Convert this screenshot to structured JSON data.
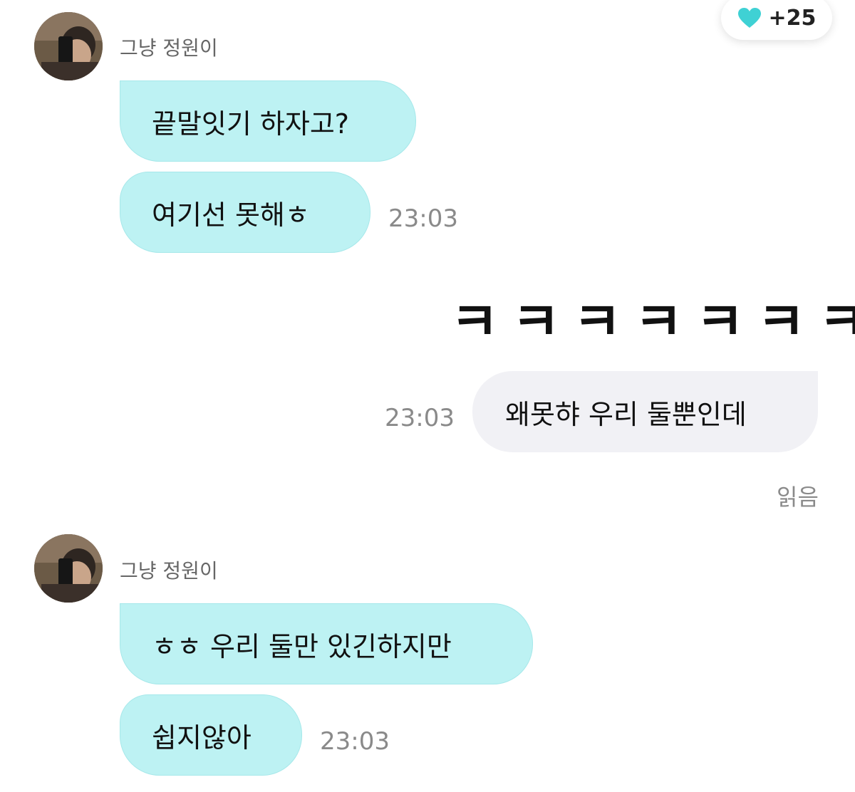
{
  "header": {
    "like_count": "+25",
    "like_icon": "heart-icon",
    "like_color": "#3fd1d4"
  },
  "messages": {
    "group1": {
      "sender": "그냥 정원이",
      "bubbles": [
        "끝말잇기 하자고?",
        "여기선 못해ㅎ"
      ],
      "time": "23:03"
    },
    "emoji_text": "ㅋㅋㅋㅋㅋㅋㅋ",
    "outgoing": {
      "text": "왜못햐 우리 둘뿐인데",
      "time": "23:03",
      "status": "읽음"
    },
    "group2": {
      "sender": "그냥 정원이",
      "bubbles": [
        "ㅎㅎ 우리 둘만 있긴하지만",
        "쉽지않아"
      ],
      "time": "23:03"
    }
  },
  "colors": {
    "incoming_bubble": "#bdf2f3",
    "outgoing_bubble": "#f1f1f5"
  }
}
